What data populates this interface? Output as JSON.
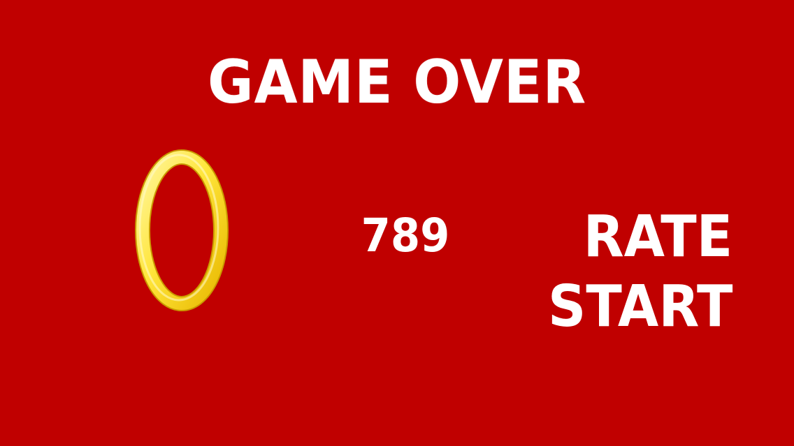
{
  "screen": {
    "title": "GAME OVER",
    "score": "789",
    "buttons": {
      "rate": "RATE",
      "start": "START"
    }
  },
  "icons": {
    "ring": "gold-ring-icon"
  },
  "colors": {
    "background": "#c00000",
    "text": "#ffffff",
    "ring_gold": "#ffe84a"
  }
}
